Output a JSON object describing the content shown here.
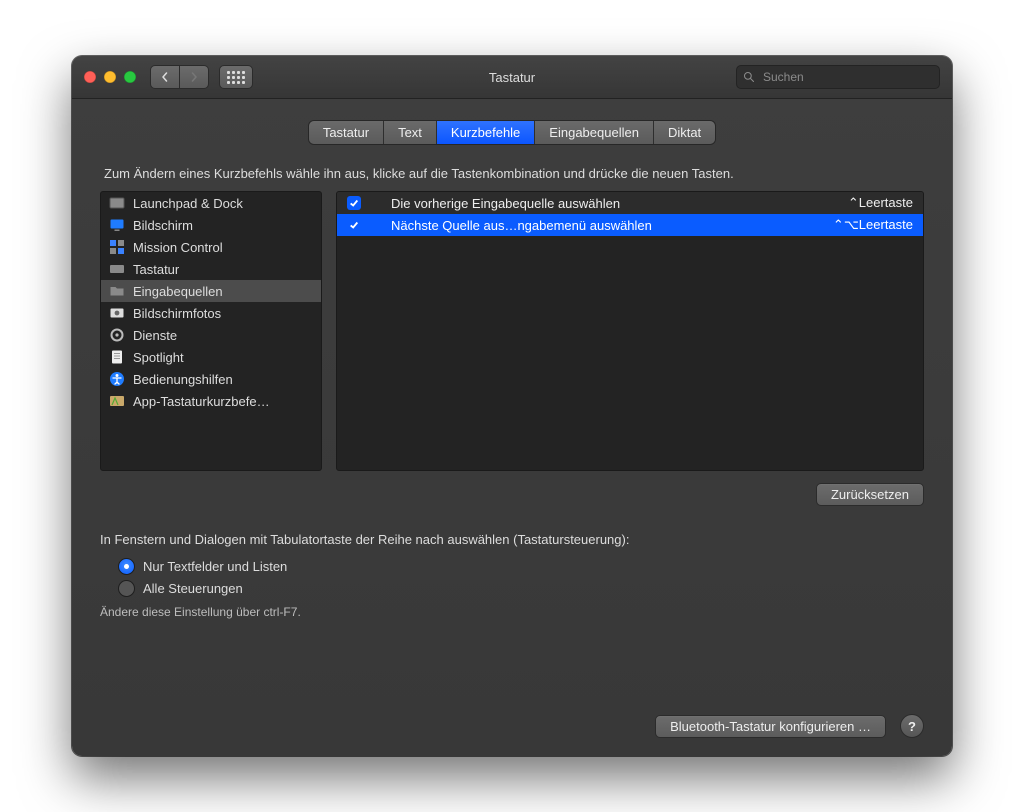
{
  "window": {
    "title": "Tastatur"
  },
  "search": {
    "placeholder": "Suchen"
  },
  "tabs": [
    {
      "label": "Tastatur",
      "active": false
    },
    {
      "label": "Text",
      "active": false
    },
    {
      "label": "Kurzbefehle",
      "active": true
    },
    {
      "label": "Eingabequellen",
      "active": false
    },
    {
      "label": "Diktat",
      "active": false
    }
  ],
  "instruction": "Zum Ändern eines Kurzbefehls wähle ihn aus, klicke auf die Tastenkombination und drücke die neuen Tasten.",
  "categories": [
    {
      "icon": "launchpad",
      "label": "Launchpad & Dock",
      "selected": false
    },
    {
      "icon": "display",
      "label": "Bildschirm",
      "selected": false
    },
    {
      "icon": "mission",
      "label": "Mission Control",
      "selected": false
    },
    {
      "icon": "keyboard",
      "label": "Tastatur",
      "selected": false
    },
    {
      "icon": "folder",
      "label": "Eingabequellen",
      "selected": true
    },
    {
      "icon": "screenshot",
      "label": "Bildschirmfotos",
      "selected": false
    },
    {
      "icon": "gear",
      "label": "Dienste",
      "selected": false
    },
    {
      "icon": "spotlight",
      "label": "Spotlight",
      "selected": false
    },
    {
      "icon": "access",
      "label": "Bedienungshilfen",
      "selected": false
    },
    {
      "icon": "apps",
      "label": "App-Tastaturkurzbefe…",
      "selected": false
    }
  ],
  "shortcuts": [
    {
      "checked": true,
      "label": "Die vorherige Eingabequelle auswählen",
      "keys": "⌃Leertaste",
      "selected": false
    },
    {
      "checked": true,
      "label": "Nächste Quelle aus…ngabemenü auswählen",
      "keys": "⌃⌥Leertaste",
      "selected": true
    }
  ],
  "reset_label": "Zurücksetzen",
  "tabcontrol": {
    "heading": "In Fenstern und Dialogen mit Tabulatortaste der Reihe nach auswählen (Tastatursteuerung):",
    "options": [
      {
        "label": "Nur Textfelder und Listen",
        "checked": true
      },
      {
        "label": "Alle Steuerungen",
        "checked": false
      }
    ],
    "hint": "Ändere diese Einstellung über ctrl-F7."
  },
  "footer": {
    "bluetooth": "Bluetooth-Tastatur konfigurieren …"
  }
}
